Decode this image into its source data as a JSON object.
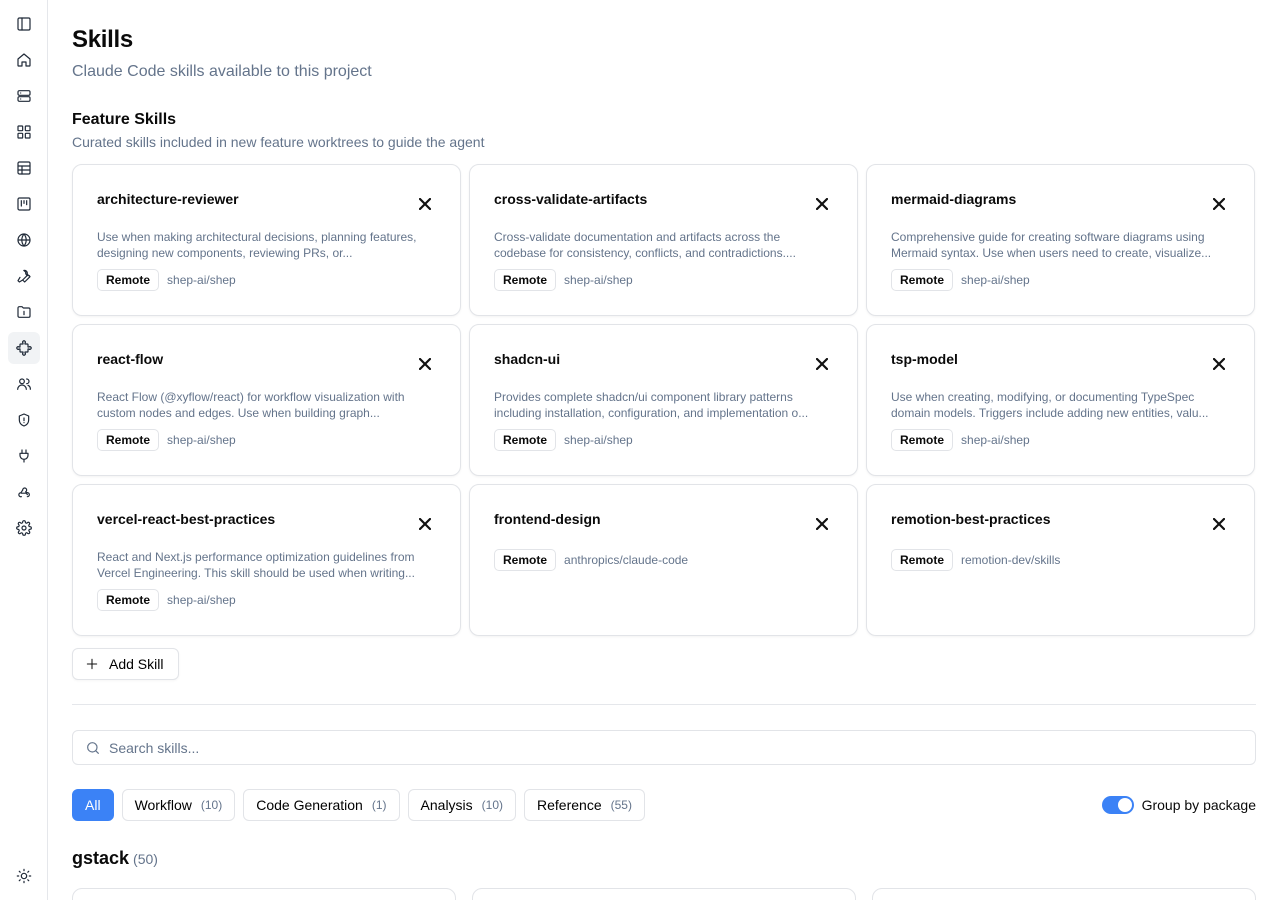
{
  "page": {
    "title": "Skills",
    "subtitle": "Claude Code skills available to this project"
  },
  "sidebar": {
    "items": [
      {
        "icon": "panel-left-icon"
      },
      {
        "icon": "home-icon"
      },
      {
        "icon": "server-icon"
      },
      {
        "icon": "grid-icon"
      },
      {
        "icon": "table-icon"
      },
      {
        "icon": "kanban-icon"
      },
      {
        "icon": "globe-icon"
      },
      {
        "icon": "wrench-icon"
      },
      {
        "icon": "folder-icon"
      },
      {
        "icon": "puzzle-icon",
        "active": true
      },
      {
        "icon": "users-icon"
      },
      {
        "icon": "shield-icon"
      },
      {
        "icon": "plug-icon"
      },
      {
        "icon": "webhook-icon"
      },
      {
        "icon": "gear-icon"
      }
    ],
    "footer_icon": "sun-icon"
  },
  "feature_skills": {
    "title": "Feature Skills",
    "subtitle": "Curated skills included in new feature worktrees to guide the agent",
    "items": [
      {
        "name": "architecture-reviewer",
        "description": "Use when making architectural decisions, planning features, designing new components, reviewing PRs, or...",
        "badge": "Remote",
        "package": "shep-ai/shep"
      },
      {
        "name": "cross-validate-artifacts",
        "description": "Cross-validate documentation and artifacts across the codebase for consistency, conflicts, and contradictions....",
        "badge": "Remote",
        "package": "shep-ai/shep"
      },
      {
        "name": "mermaid-diagrams",
        "description": "Comprehensive guide for creating software diagrams using Mermaid syntax. Use when users need to create, visualize...",
        "badge": "Remote",
        "package": "shep-ai/shep"
      },
      {
        "name": "react-flow",
        "description": "React Flow (@xyflow/react) for workflow visualization with custom nodes and edges. Use when building graph...",
        "badge": "Remote",
        "package": "shep-ai/shep"
      },
      {
        "name": "shadcn-ui",
        "description": "Provides complete shadcn/ui component library patterns including installation, configuration, and implementation o...",
        "badge": "Remote",
        "package": "shep-ai/shep"
      },
      {
        "name": "tsp-model",
        "description": "Use when creating, modifying, or documenting TypeSpec domain models. Triggers include adding new entities, valu...",
        "badge": "Remote",
        "package": "shep-ai/shep"
      },
      {
        "name": "vercel-react-best-practices",
        "description": "React and Next.js performance optimization guidelines from Vercel Engineering. This skill should be used when writing...",
        "badge": "Remote",
        "package": "shep-ai/shep"
      },
      {
        "name": "frontend-design",
        "description": "",
        "badge": "Remote",
        "package": "anthropics/claude-code"
      },
      {
        "name": "remotion-best-practices",
        "description": "",
        "badge": "Remote",
        "package": "remotion-dev/skills"
      }
    ],
    "add_label": "Add Skill"
  },
  "search": {
    "placeholder": "Search skills..."
  },
  "filters": [
    {
      "label": "All",
      "count": "",
      "active": true
    },
    {
      "label": "Workflow",
      "count": "(10)"
    },
    {
      "label": "Code Generation",
      "count": "(1)"
    },
    {
      "label": "Analysis",
      "count": "(10)"
    },
    {
      "label": "Reference",
      "count": "(55)"
    }
  ],
  "group_toggle": {
    "label": "Group by package",
    "on": true
  },
  "group": {
    "name": "gstack",
    "count": "(50)"
  },
  "colors": {
    "accent": "#3b82f6",
    "muted_text": "#64748b",
    "border": "#e2e4e8"
  }
}
